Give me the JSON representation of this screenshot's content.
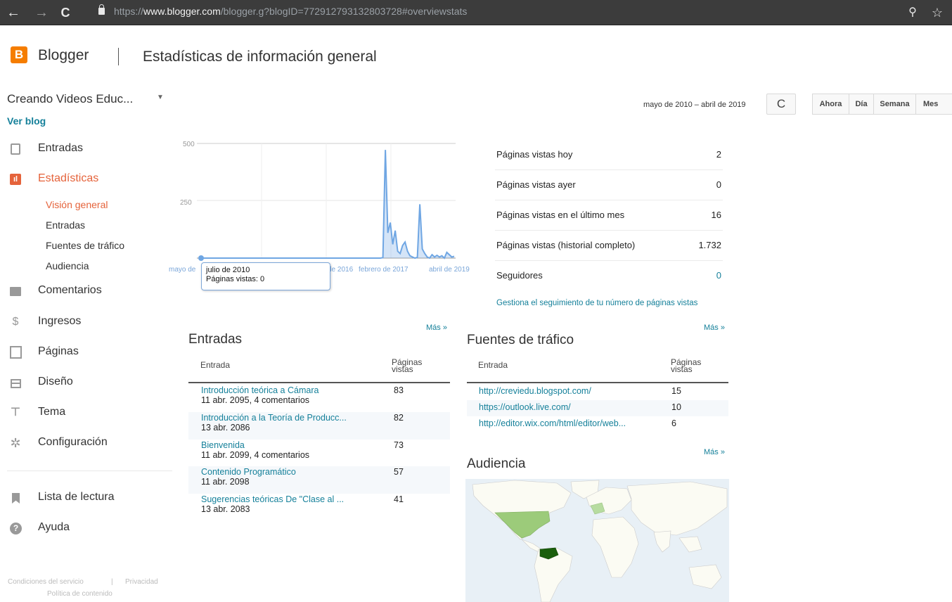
{
  "browser": {
    "url_scheme": "https://",
    "url_host": "www.blogger.com",
    "url_path": "/blogger.g?blogID=772912793132803728#overviewstats",
    "back_icon": "←",
    "forward_icon": "→",
    "reload_icon": "C",
    "zoom_icon": "⚲",
    "star_icon": "☆"
  },
  "header": {
    "logo_letter": "B",
    "app_name": "Blogger",
    "page_title": "Estadísticas de información general"
  },
  "blog": {
    "name": "Creando Videos Educ...",
    "caret": "▼",
    "view_blog": "Ver blog"
  },
  "sidebar": {
    "items": [
      {
        "label": "Entradas",
        "icon": "posts-icon"
      },
      {
        "label": "Estadísticas",
        "icon": "stats-icon"
      },
      {
        "label": "Comentarios",
        "icon": "comments-icon"
      },
      {
        "label": "Ingresos",
        "icon": "earnings-icon"
      },
      {
        "label": "Páginas",
        "icon": "pages-icon"
      },
      {
        "label": "Diseño",
        "icon": "layout-icon"
      },
      {
        "label": "Tema",
        "icon": "theme-icon"
      },
      {
        "label": "Configuración",
        "icon": "settings-icon"
      },
      {
        "label": "Lista de lectura",
        "icon": "reading-list-icon"
      },
      {
        "label": "Ayuda",
        "icon": "help-icon"
      }
    ],
    "stats_sub": [
      "Visión general",
      "Entradas",
      "Fuentes de tráfico",
      "Audiencia"
    ],
    "footer": {
      "terms": "Condiciones del servicio",
      "separator": "|",
      "privacy": "Privacidad",
      "content_policy": "Política de contenido"
    }
  },
  "range": {
    "label": "mayo de 2010 – abril de 2019",
    "refresh_icon": "C",
    "buttons": [
      "Ahora",
      "Día",
      "Semana",
      "Mes"
    ]
  },
  "chart_data": {
    "type": "area",
    "y_ticks": [
      "500",
      "250"
    ],
    "ylim": [
      0,
      500
    ],
    "x_tick_labels": [
      "mayo de",
      "de 2016",
      "febrero de 2017",
      "abril de 2019"
    ],
    "points": [
      0,
      0,
      0,
      0,
      0,
      0,
      0,
      0,
      0,
      0,
      0,
      0,
      0,
      0,
      0,
      0,
      0,
      0,
      0,
      0,
      0,
      0,
      0,
      0,
      0,
      0,
      0,
      0,
      0,
      0,
      0,
      0,
      0,
      0,
      0,
      0,
      0,
      0,
      0,
      0,
      0,
      0,
      0,
      0,
      0,
      0,
      0,
      0,
      0,
      0,
      0,
      0,
      0,
      0,
      0,
      0,
      0,
      0,
      0,
      0,
      0,
      0,
      0,
      0,
      0,
      0,
      0,
      0,
      0,
      0,
      0,
      0,
      0,
      0,
      2,
      472,
      110,
      155,
      60,
      120,
      30,
      20,
      55,
      70,
      30,
      10,
      5,
      0,
      3,
      235,
      40,
      20,
      5,
      0,
      15,
      5,
      12,
      5,
      10,
      0,
      25,
      15,
      5,
      8
    ],
    "color": "#6fa6e3",
    "tooltip": {
      "title": "julio de 2010",
      "line": "Páginas vistas: 0"
    }
  },
  "stats": {
    "rows": [
      {
        "label": "Páginas vistas hoy",
        "value": "2"
      },
      {
        "label": "Páginas vistas ayer",
        "value": "0"
      },
      {
        "label": "Páginas vistas en el último mes",
        "value": "16"
      },
      {
        "label": "Páginas vistas (historial completo)",
        "value": "1.732"
      },
      {
        "label": "Seguidores",
        "value": "0"
      }
    ],
    "manage_link": "Gestiona el seguimiento de tu número de páginas vistas"
  },
  "posts": {
    "more": "Más »",
    "title": "Entradas",
    "col_entry": "Entrada",
    "col_views_1": "Páginas",
    "col_views_2": "vistas",
    "rows": [
      {
        "title": "Introducción teórica a Cámara",
        "meta": "11 abr. 2095, 4 comentarios",
        "views": "83"
      },
      {
        "title": "Introducción a la Teoría de Producc...",
        "meta": "13 abr. 2086",
        "views": "82"
      },
      {
        "title": "Bienvenida",
        "meta": "11 abr. 2099, 4 comentarios",
        "views": "73"
      },
      {
        "title": "Contenido Programático",
        "meta": "11 abr. 2098",
        "views": "57"
      },
      {
        "title": "Sugerencias teóricas De \"Clase al ...",
        "meta": "13 abr. 2083",
        "views": "41"
      }
    ]
  },
  "traffic": {
    "more": "Más »",
    "title": "Fuentes de tráfico",
    "col_entry": "Entrada",
    "col_views_1": "Páginas",
    "col_views_2": "vistas",
    "rows": [
      {
        "url": "http://creviedu.blogspot.com/",
        "views": "15"
      },
      {
        "url": "https://outlook.live.com/",
        "views": "10"
      },
      {
        "url": "http://editor.wix.com/html/editor/web...",
        "views": "6"
      }
    ]
  },
  "audience": {
    "more": "Más »",
    "title": "Audiencia"
  }
}
